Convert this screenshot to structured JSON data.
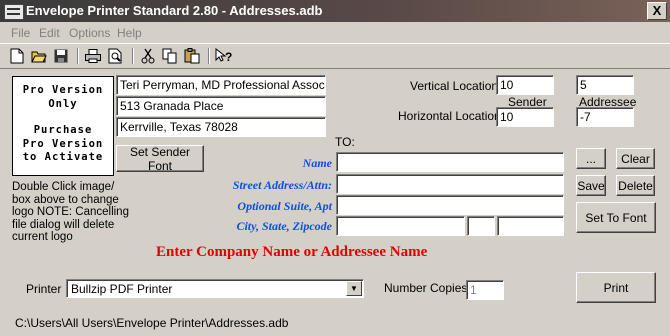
{
  "window": {
    "title": "Envelope Printer Standard 2.80 - Addresses.adb",
    "close_label": "X"
  },
  "menu": {
    "items": [
      "File",
      "Edit",
      "Options",
      "Help"
    ]
  },
  "toolbar": {
    "icons": [
      "new-icon",
      "open-icon",
      "save-icon",
      "print-icon",
      "print-preview-icon",
      "cut-icon",
      "copy-icon",
      "paste-icon",
      "help-icon"
    ]
  },
  "logo": {
    "lines": [
      "Pro Version",
      "Only",
      "",
      "Purchase",
      "Pro Version",
      "to Activate"
    ]
  },
  "sender": {
    "line1": "Teri Perryman, MD Professional Associatio",
    "line2": "513 Granada Place",
    "line3": "Kerrville, Texas 78028",
    "set_font_label": "Set Sender Font",
    "note": "Double Click image/ box above to change logo NOTE: Cancelling file dialog will delete current logo"
  },
  "locations": {
    "vertical_label": "Vertical Locations",
    "horizontal_label": "Horizontal Locations",
    "sender_header": "Sender",
    "addressee_header": "Addressee",
    "vertical_sender": "10",
    "vertical_addressee": "5",
    "horizontal_sender": "10",
    "horizontal_addressee": "-7"
  },
  "to": {
    "label": "TO:",
    "name_label": "Name",
    "street_label": "Street Address/Attn:",
    "suite_label": "Optional Suite, Apt",
    "city_label": "City, State, Zipcode",
    "name": "",
    "street": "",
    "suite": "",
    "city": "",
    "state": "",
    "zip": ""
  },
  "buttons": {
    "browse": "...",
    "clear": "Clear",
    "save": "Save",
    "delete": "Delete",
    "set_to_font": "Set To Font",
    "print": "Print"
  },
  "prompt": "Enter Company Name or Addressee Name",
  "printer": {
    "label": "Printer",
    "selected": "Bullzip PDF Printer"
  },
  "copies": {
    "label": "Number Copies",
    "value": "1"
  },
  "status": {
    "path": "C:\\Users\\All Users\\Envelope Printer\\Addresses.adb"
  },
  "colors": {
    "label_blue": "#0d4fe3",
    "prompt_red": "#e00000",
    "face": "#d4d0c8"
  }
}
